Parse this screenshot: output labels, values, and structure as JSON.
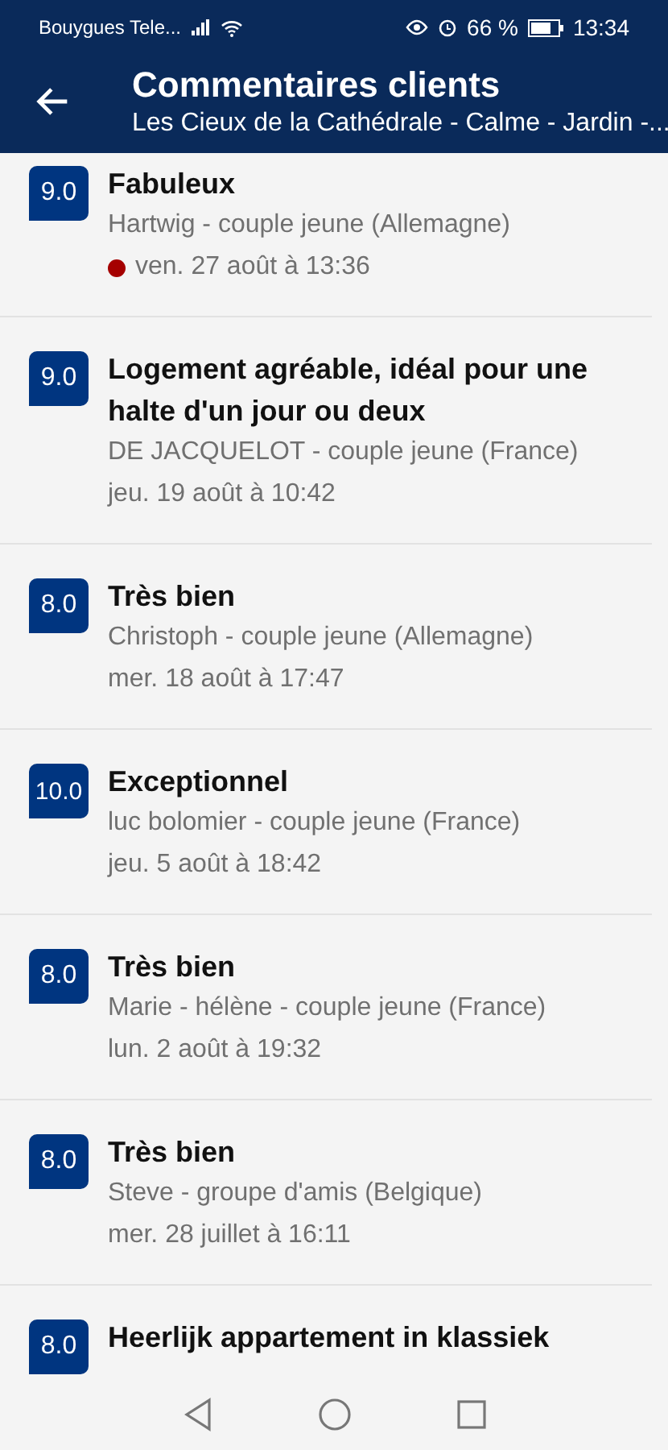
{
  "status_bar": {
    "carrier": "Bouygues Tele...",
    "battery": "66 %",
    "time": "13:34"
  },
  "header": {
    "title": "Commentaires clients",
    "subtitle": "Les Cieux de la Cathédrale - Calme - Jardin -..."
  },
  "reviews": [
    {
      "score": "9.0",
      "title": "Fabuleux",
      "author": "Hartwig - couple jeune (Allemagne)",
      "date": "ven. 27 août à 13:36",
      "unread": true
    },
    {
      "score": "9.0",
      "title": "Logement agréable, idéal pour une halte d'un jour ou deux",
      "author": "DE JACQUELOT - couple jeune (France)",
      "date": "jeu. 19 août à 10:42",
      "unread": false
    },
    {
      "score": "8.0",
      "title": "Très bien",
      "author": "Christoph - couple jeune (Allemagne)",
      "date": "mer. 18 août à 17:47",
      "unread": false
    },
    {
      "score": "10.0",
      "title": "Exceptionnel",
      "author": "luc bolomier - couple jeune (France)",
      "date": "jeu. 5 août à 18:42",
      "unread": false
    },
    {
      "score": "8.0",
      "title": "Très bien",
      "author": "Marie - hélène - couple jeune (France)",
      "date": "lun. 2 août à 19:32",
      "unread": false
    },
    {
      "score": "8.0",
      "title": "Très bien",
      "author": "Steve - groupe d'amis (Belgique)",
      "date": "mer. 28 juillet à 16:11",
      "unread": false
    },
    {
      "score": "8.0",
      "title": "Heerlijk appartement in klassiek"
    }
  ]
}
